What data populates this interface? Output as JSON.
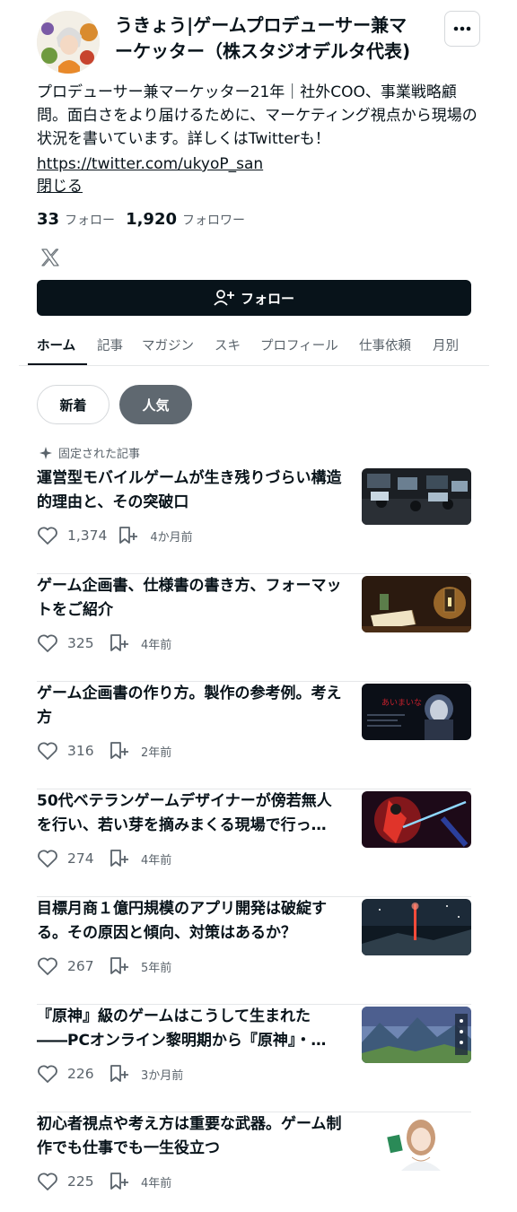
{
  "profile": {
    "name": "うきょう|ゲームプロデューサー兼マーケッター（株スタジオデルタ代表)",
    "bio": "プロデューサー兼マーケッター21年｜社外COO、事業戦略顧問。面白さをより届けるために、マーケティング視点から現場の状況を書いています。詳しくはTwitterも！",
    "link": "https://twitter.com/ukyoP_san",
    "close_label": "閉じる",
    "following_count": "33",
    "following_label": "フォロー",
    "followers_count": "1,920",
    "followers_label": "フォロワー",
    "social_icon": "x-icon",
    "follow_button": "フォロー"
  },
  "tabs": [
    "ホーム",
    "記事",
    "マガジン",
    "スキ",
    "プロフィール",
    "仕事依頼",
    "月別"
  ],
  "active_tab": "ホーム",
  "filters": {
    "new": "新着",
    "popular": "人気",
    "selected": "人気"
  },
  "pinned_label": "固定された記事",
  "articles": [
    {
      "title": "運営型モバイルゲームが生き残りづらい構造的理由と、その突破口",
      "likes": "1,374",
      "date": "4か月前",
      "thumb": "office"
    },
    {
      "title": "ゲーム企画書、仕様書の書き方、フォーマットをご紹介",
      "likes": "325",
      "date": "4年前",
      "thumb": "lantern-book"
    },
    {
      "title": "ゲーム企画書の作り方。製作の参考例。考え方",
      "likes": "316",
      "date": "2年前",
      "thumb": "dark-game"
    },
    {
      "title": "50代ベテランゲームデザイナーが傍若無人を行い、若い芽を摘みまくる現場で行っ…",
      "likes": "274",
      "date": "4年前",
      "thumb": "red-warrior"
    },
    {
      "title": "目標月商１億円規模のアプリ開発は破綻する。その原因と傾向、対策はあるか？",
      "likes": "267",
      "date": "5年前",
      "thumb": "sword-night"
    },
    {
      "title": "『原神』級のゲームはこうして生まれた――PCオンライン黎明期から『原神』・…",
      "likes": "226",
      "date": "3か月前",
      "thumb": "fantasy-landscape"
    },
    {
      "title": "初心者視点や考え方は重要な武器。ゲーム制作でも仕事でも一生役立つ",
      "likes": "225",
      "date": "4年前",
      "thumb": "girl-illustration"
    }
  ],
  "colors": {
    "text": "#08131a",
    "muted": "#5a636b",
    "follow_bg": "#08131a",
    "chip_active": "#5f6870",
    "divider": "#e5e7e9"
  }
}
